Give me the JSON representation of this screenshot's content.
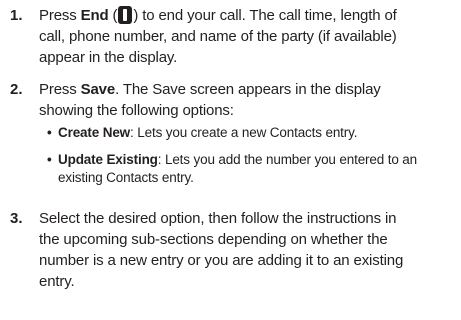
{
  "steps": [
    {
      "number": "1.",
      "pre": "Press ",
      "key_name": "End",
      "key_icon": "end-call-key-icon",
      "post_line1": ") to end your call. The call time, length of",
      "line2": "call, phone number, and name of the party (if available)",
      "line3": "appear in the display."
    },
    {
      "number": "2.",
      "pre": "Press ",
      "key_name": "Save",
      "post_line1": ". The Save screen appears in the display",
      "line2": "showing the following options:",
      "options": [
        {
          "name": "Create New",
          "desc_line1": ": Lets you create a new Contacts entry."
        },
        {
          "name": "Update Existing",
          "desc_line1": ": Lets you add the number you entered to an",
          "desc_line2": "existing Contacts entry."
        }
      ]
    },
    {
      "number": "3.",
      "line1": "Select the desired option, then follow the instructions in",
      "line2": "the upcoming sub-sections depending on whether the",
      "line3": "number is a new entry or you are adding it to an existing",
      "line4": "entry."
    }
  ],
  "colors": {
    "text": "#231f20",
    "background": "#ffffff"
  }
}
